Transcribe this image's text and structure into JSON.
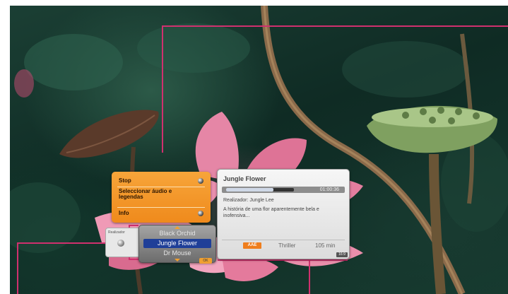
{
  "menu": {
    "items": [
      {
        "label": "Stop"
      },
      {
        "label": "Seleccionar áudio e legendas"
      },
      {
        "label": "Info"
      }
    ]
  },
  "info_panel": {
    "title": "Jungle Flower",
    "time": "01:00:36",
    "progress": 0.7,
    "director": "Realizador: Jungle Lee",
    "description": "A história de uma flor aparentemente bela e inofensiva...",
    "badge": "AAE",
    "genre": "Thriller",
    "duration": "105 min",
    "corner_badge": "16:9"
  },
  "small_panel": {
    "label": "Realizador"
  },
  "selector": {
    "options": [
      {
        "label": "Black Orchid",
        "selected": false
      },
      {
        "label": "Jungle Flower",
        "selected": true
      },
      {
        "label": "Dr Mouse",
        "selected": false
      }
    ],
    "badge": "OK"
  },
  "colors": {
    "accent_orange": "#ef8a1c",
    "callout_line": "#d0306e",
    "selection_blue": "#1f3f98"
  }
}
